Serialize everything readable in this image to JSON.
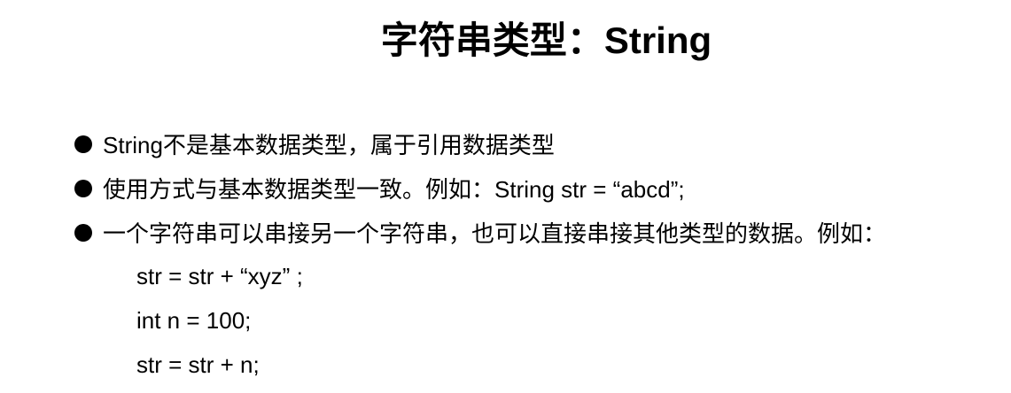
{
  "slide": {
    "title": "字符串类型：String",
    "bullets": [
      "String不是基本数据类型，属于引用数据类型",
      "使用方式与基本数据类型一致。例如：String str = “abcd”;",
      "一个字符串可以串接另一个字符串，也可以直接串接其他类型的数据。例如："
    ],
    "code_lines": [
      "str = str + “xyz” ;",
      "int n = 100;",
      "str = str + n;"
    ]
  }
}
